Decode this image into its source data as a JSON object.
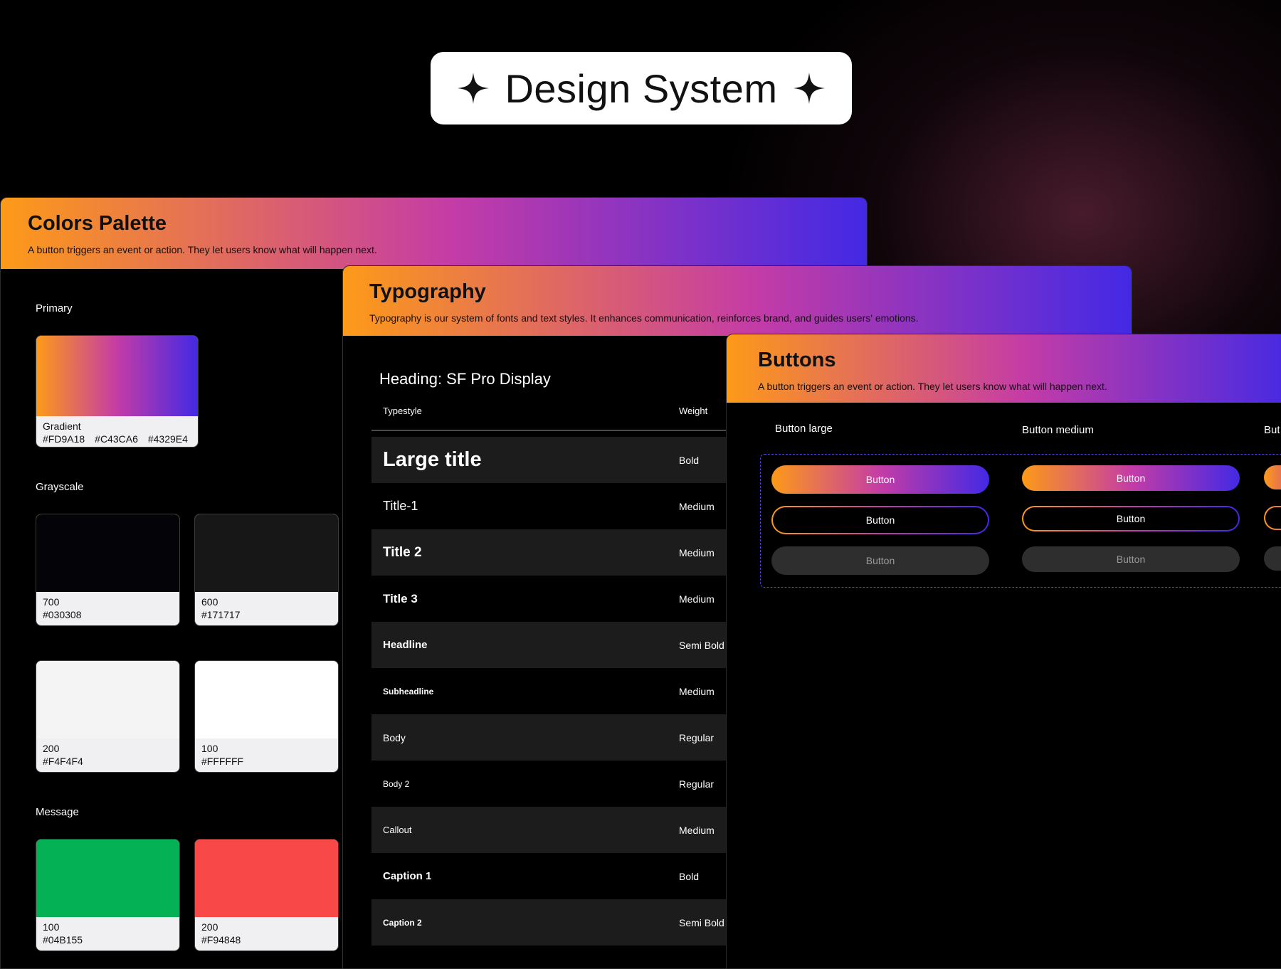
{
  "hero": {
    "title": "Design System"
  },
  "colors_card": {
    "title": "Colors Palette",
    "description": "A button triggers an event or action. They let users know what will happen next.",
    "primary_label": "Primary",
    "gradient": {
      "name": "Gradient",
      "hex": [
        "#FD9A18",
        "#C43CA6",
        "#4329E4"
      ]
    },
    "grayscale_label": "Grayscale",
    "grayscale": [
      {
        "shade": "700",
        "hex": "#030308",
        "color": "#030308"
      },
      {
        "shade": "600",
        "hex": "#171717",
        "color": "#171717"
      },
      {
        "shade": "200",
        "hex": "#F4F4F4",
        "color": "#F4F4F4"
      },
      {
        "shade": "100",
        "hex": "#FFFFFF",
        "color": "#FFFFFF"
      }
    ],
    "message_label": "Message",
    "message": [
      {
        "shade": "100",
        "hex": "#04B155",
        "color": "#04B155"
      },
      {
        "shade": "200",
        "hex": "#F94848",
        "color": "#F94848"
      }
    ]
  },
  "typography_card": {
    "title": "Typography",
    "description": "Typography is our system of fonts and text styles. It enhances communication, reinforces brand, and guides users' emotions.",
    "heading": "Heading: SF Pro Display",
    "col_typestyle": "Typestyle",
    "col_weight": "Weight",
    "rows": [
      {
        "name": "Large title",
        "weight": "Bold"
      },
      {
        "name": "Title-1",
        "weight": "Medium"
      },
      {
        "name": "Title 2",
        "weight": "Medium"
      },
      {
        "name": "Title 3",
        "weight": "Medium"
      },
      {
        "name": "Headline",
        "weight": "Semi Bold"
      },
      {
        "name": "Subheadline",
        "weight": "Medium"
      },
      {
        "name": "Body",
        "weight": "Regular"
      },
      {
        "name": "Body 2",
        "weight": "Regular"
      },
      {
        "name": "Callout",
        "weight": "Medium"
      },
      {
        "name": "Caption 1",
        "weight": "Bold"
      },
      {
        "name": "Caption 2",
        "weight": "Semi Bold"
      }
    ]
  },
  "buttons_card": {
    "title": "Buttons",
    "description": "A button triggers an event or action. They let users know what will happen next.",
    "col_large": "Button large",
    "col_medium": "Button medium",
    "col_small": "But",
    "button_label": "Button"
  },
  "colors": {
    "gradient_start": "#FD9A18",
    "gradient_mid": "#C43CA6",
    "gradient_end": "#4329E4"
  }
}
